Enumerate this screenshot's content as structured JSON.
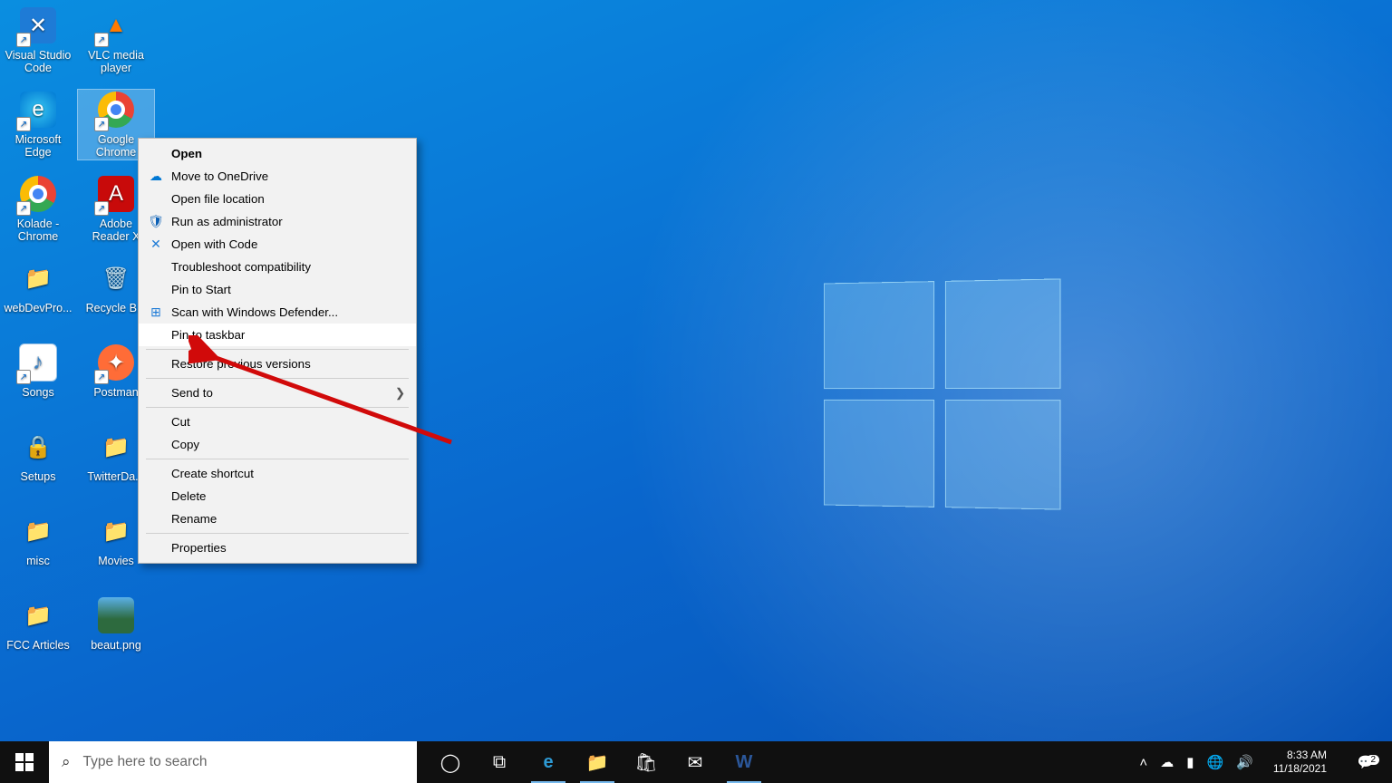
{
  "desktop_icons": [
    {
      "id": "vscode",
      "label": "Visual Studio Code",
      "col": 0,
      "row": 0,
      "glyph": "✕",
      "cls": "vscode",
      "shortcut": true
    },
    {
      "id": "vlc",
      "label": "VLC media player",
      "col": 1,
      "row": 0,
      "glyph": "▲",
      "cls": "vlc",
      "shortcut": true
    },
    {
      "id": "edge",
      "label": "Microsoft Edge",
      "col": 0,
      "row": 1,
      "glyph": "e",
      "cls": "edge",
      "shortcut": true
    },
    {
      "id": "chrome",
      "label": "Google Chrome",
      "col": 1,
      "row": 1,
      "glyph": "",
      "cls": "chrome",
      "shortcut": true,
      "selected": true
    },
    {
      "id": "kolade",
      "label": "Kolade - Chrome",
      "col": 0,
      "row": 2,
      "glyph": "",
      "cls": "chrome",
      "shortcut": true
    },
    {
      "id": "acrobat",
      "label": "Adobe Reader X",
      "col": 1,
      "row": 2,
      "glyph": "A",
      "cls": "acrobat",
      "shortcut": true
    },
    {
      "id": "webdev",
      "label": "webDevPro...",
      "col": 0,
      "row": 3,
      "glyph": "📁",
      "cls": "folder"
    },
    {
      "id": "recycle",
      "label": "Recycle B...",
      "col": 1,
      "row": 3,
      "glyph": "🗑",
      "cls": "recycle"
    },
    {
      "id": "songs",
      "label": "Songs",
      "col": 0,
      "row": 4,
      "glyph": "♪",
      "cls": "music",
      "shortcut": true
    },
    {
      "id": "postman",
      "label": "Postman",
      "col": 1,
      "row": 4,
      "glyph": "✦",
      "cls": "postman",
      "shortcut": true
    },
    {
      "id": "setups",
      "label": "Setups",
      "col": 0,
      "row": 5,
      "glyph": "🔒",
      "cls": "lock"
    },
    {
      "id": "twitter",
      "label": "TwitterDa...",
      "col": 1,
      "row": 5,
      "glyph": "📁",
      "cls": "folder"
    },
    {
      "id": "misc",
      "label": "misc",
      "col": 0,
      "row": 6,
      "glyph": "📁",
      "cls": "folder"
    },
    {
      "id": "movies",
      "label": "Movies",
      "col": 1,
      "row": 6,
      "glyph": "📁",
      "cls": "folder"
    },
    {
      "id": "fcc",
      "label": "FCC Articles",
      "col": 0,
      "row": 7,
      "glyph": "📁",
      "cls": "folder"
    },
    {
      "id": "beaut",
      "label": "beaut.png",
      "col": 1,
      "row": 7,
      "glyph": "",
      "cls": "pic"
    }
  ],
  "context_menu": {
    "items": [
      {
        "label": "Open",
        "bold": true
      },
      {
        "label": "Move to OneDrive",
        "icon": "onedrive",
        "iconGlyph": "☁"
      },
      {
        "label": "Open file location"
      },
      {
        "label": "Run as administrator",
        "icon": "shield",
        "iconGlyph": "🛡"
      },
      {
        "label": "Open with Code",
        "icon": "code",
        "iconGlyph": "✕"
      },
      {
        "label": "Troubleshoot compatibility"
      },
      {
        "label": "Pin to Start"
      },
      {
        "label": "Scan with Windows Defender...",
        "icon": "defender",
        "iconGlyph": "⊞"
      },
      {
        "label": "Pin to taskbar",
        "highlight": true
      },
      {
        "sep": true
      },
      {
        "label": "Restore previous versions"
      },
      {
        "sep": true
      },
      {
        "label": "Send to",
        "submenu": true
      },
      {
        "sep": true
      },
      {
        "label": "Cut"
      },
      {
        "label": "Copy"
      },
      {
        "sep": true
      },
      {
        "label": "Create shortcut"
      },
      {
        "label": "Delete"
      },
      {
        "label": "Rename"
      },
      {
        "sep": true
      },
      {
        "label": "Properties"
      }
    ]
  },
  "taskbar": {
    "search_placeholder": "Type here to search",
    "buttons": [
      {
        "id": "cortana",
        "glyph": "◯"
      },
      {
        "id": "taskview",
        "glyph": "⧉"
      },
      {
        "id": "edge",
        "glyph": "e",
        "active": true,
        "color": "#2e9bd6"
      },
      {
        "id": "explorer",
        "glyph": "📁",
        "active": true
      },
      {
        "id": "store",
        "glyph": "🛍"
      },
      {
        "id": "mail",
        "glyph": "✉"
      },
      {
        "id": "word",
        "glyph": "W",
        "active": true,
        "color": "#2b579a"
      }
    ],
    "tray": [
      {
        "id": "chevron",
        "glyph": "˄"
      },
      {
        "id": "onedrive",
        "glyph": "☁"
      },
      {
        "id": "battery",
        "glyph": "▮"
      },
      {
        "id": "network",
        "glyph": "🌐"
      },
      {
        "id": "volume",
        "glyph": "🔊"
      }
    ],
    "time": "8:33 AM",
    "date": "11/18/2021",
    "notifications_count": "2"
  }
}
